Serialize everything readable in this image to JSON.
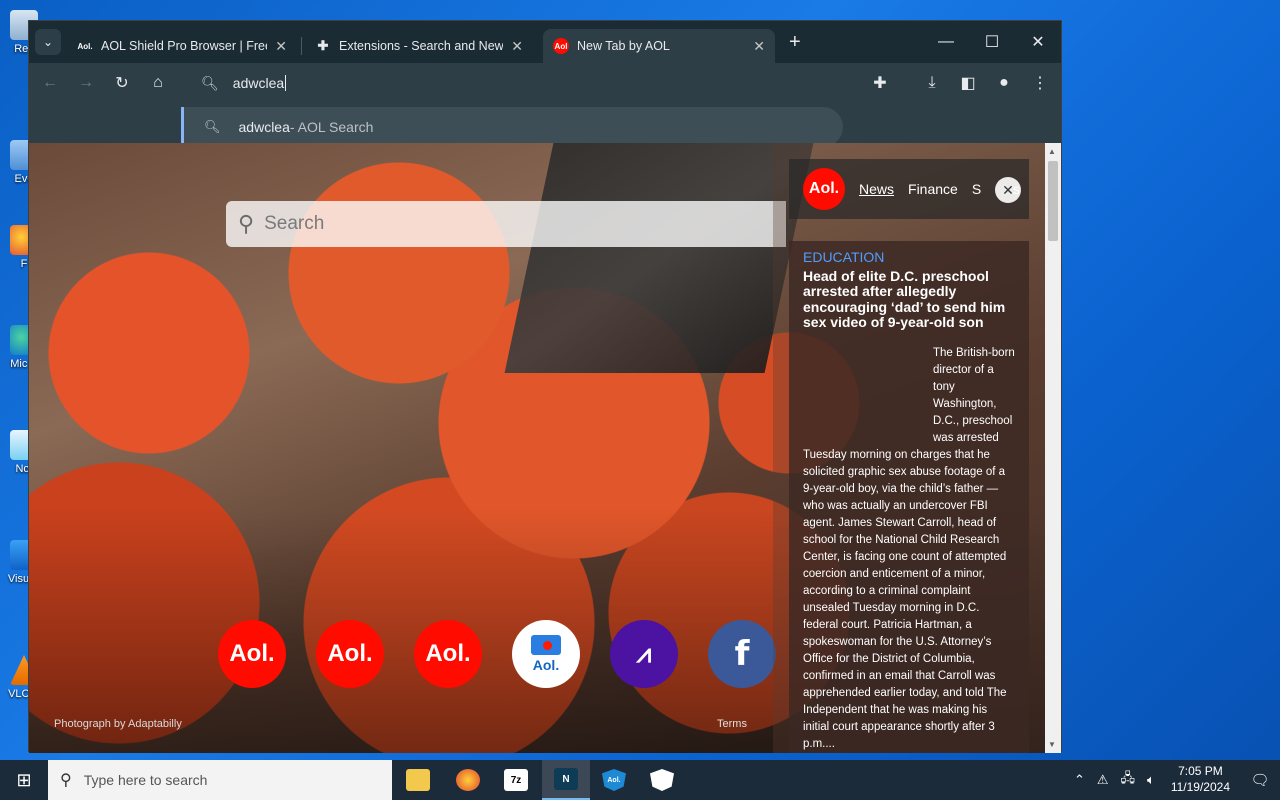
{
  "desktop": {
    "icons": [
      {
        "label": "Rec",
        "icon": "recycle-bin"
      },
      {
        "label": "Eve",
        "icon": "app"
      },
      {
        "label": "F",
        "icon": "firefox"
      },
      {
        "label": "Mic E",
        "icon": "edge"
      },
      {
        "label": "Not",
        "icon": "notepad"
      },
      {
        "label": "Visu C",
        "icon": "vscode"
      },
      {
        "label": "VLC P",
        "icon": "vlc"
      }
    ]
  },
  "browser": {
    "tabs": [
      {
        "title": "AOL Shield Pro Browser | Free",
        "favicon": "Aol.",
        "active": false
      },
      {
        "title": "Extensions - Search and New T",
        "favicon": "puzzle-icon",
        "active": false
      },
      {
        "title": "New Tab by AOL",
        "favicon": "Aol",
        "active": true
      }
    ],
    "omnibox": {
      "value": "adwclea"
    },
    "suggestion": {
      "query": "adwclea",
      "suffix": " - AOL Search"
    }
  },
  "page": {
    "search_placeholder": "Search",
    "shortcuts": [
      {
        "label": "Aol.",
        "type": "aol"
      },
      {
        "label": "Aol.",
        "type": "aol"
      },
      {
        "label": "Aol.",
        "type": "aol"
      },
      {
        "label": "Aol.",
        "type": "aol-mail"
      },
      {
        "label": "",
        "type": "finance"
      },
      {
        "label": "f",
        "type": "facebook"
      }
    ],
    "photo_credit": "Photograph by Adaptabilly",
    "terms": "Terms"
  },
  "news": {
    "badge": "Aol.",
    "nav": [
      "News",
      "Finance",
      "S"
    ],
    "nav_suffix": "s",
    "article": {
      "category": "EDUCATION",
      "headline": "Head of elite D.C. preschool arrested after allegedly encouraging ‘dad’ to send him sex video of 9-year-old son",
      "body": "The British-born director of a tony Washington, D.C., preschool was arrested Tuesday morning on charges that he solicited graphic sex abuse footage of a 9-year-old boy, via the child’s father — who was actually an undercover FBI agent. James Stewart Carroll, head of school for the National Child Research Center, is facing one count of attempted coercion and enticement of a minor, according to a criminal complaint unsealed Tuesday morning in D.C. federal court. Patricia Hartman, a spokeswoman for the U.S. Attorney’s Office for the District of Columbia, confirmed in an email that Carroll was apprehended earlier today, and told The Independent that he was making his initial court appearance shortly after 3 p.m...."
    }
  },
  "taskbar": {
    "search_placeholder": "Type here to search",
    "time": "7:05 PM",
    "date": "11/19/2024",
    "apps": [
      {
        "name": "file-explorer",
        "label": ""
      },
      {
        "name": "firefox",
        "label": ""
      },
      {
        "name": "7zip",
        "label": "7z"
      },
      {
        "name": "aol-browser",
        "label": "N"
      },
      {
        "name": "aol-shield",
        "label": "Aol."
      },
      {
        "name": "security",
        "label": ""
      }
    ]
  }
}
